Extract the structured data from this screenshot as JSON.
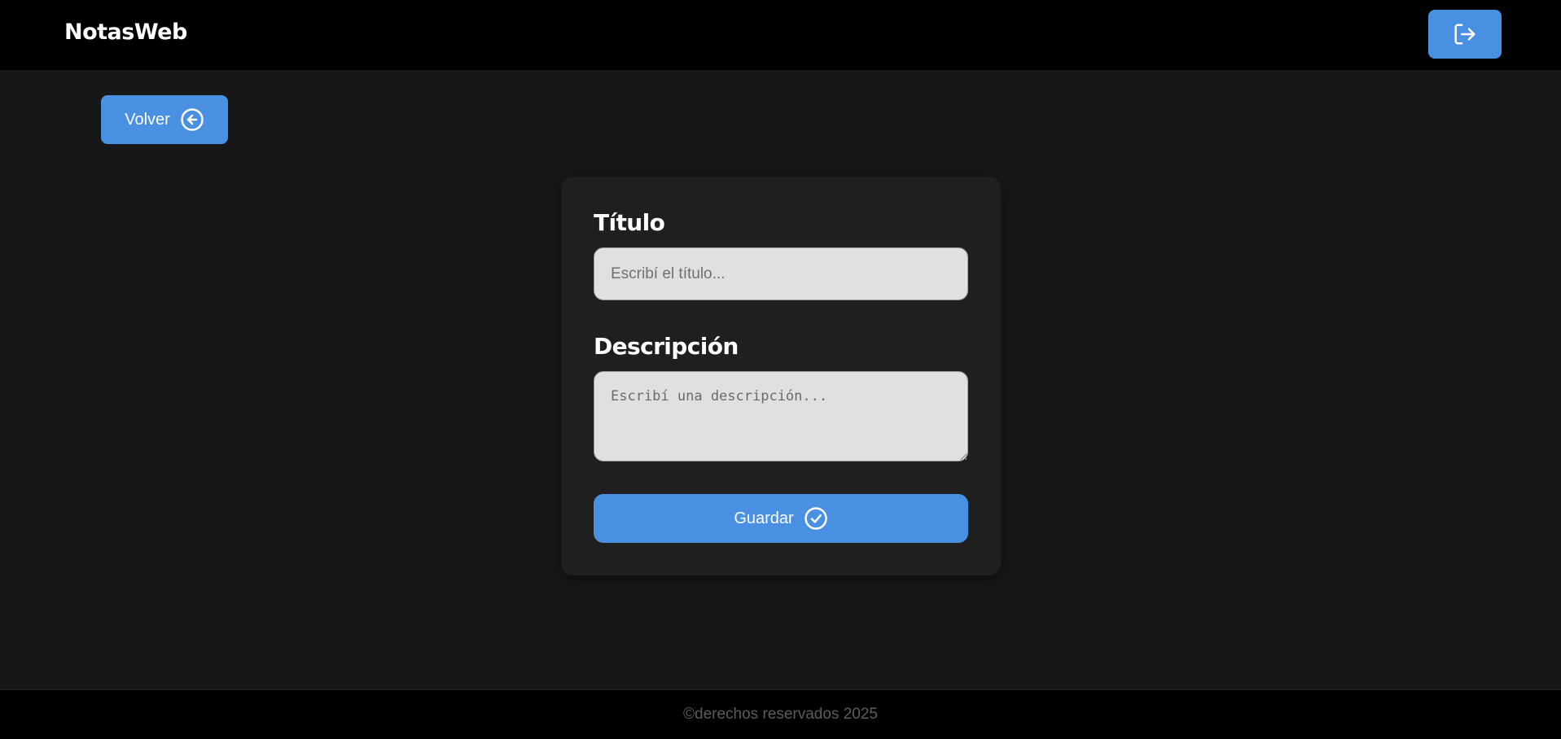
{
  "header": {
    "brand": "NotasWeb",
    "logout_icon": "logout-icon"
  },
  "nav": {
    "back_label": "Volver",
    "back_icon": "arrow-left-circle-icon"
  },
  "form": {
    "title_label": "Título",
    "title_placeholder": "Escribí el título...",
    "title_value": "",
    "description_label": "Descripción",
    "description_placeholder": "Escribí una descripción...",
    "description_value": "",
    "save_label": "Guardar",
    "save_icon": "check-circle-icon"
  },
  "footer": {
    "text": "©derechos reservados 2025"
  },
  "colors": {
    "accent": "#4a90e2",
    "background": "#171717",
    "card": "#1f1f1f",
    "topbar": "#000000",
    "input_bg": "#e0e0e0"
  }
}
